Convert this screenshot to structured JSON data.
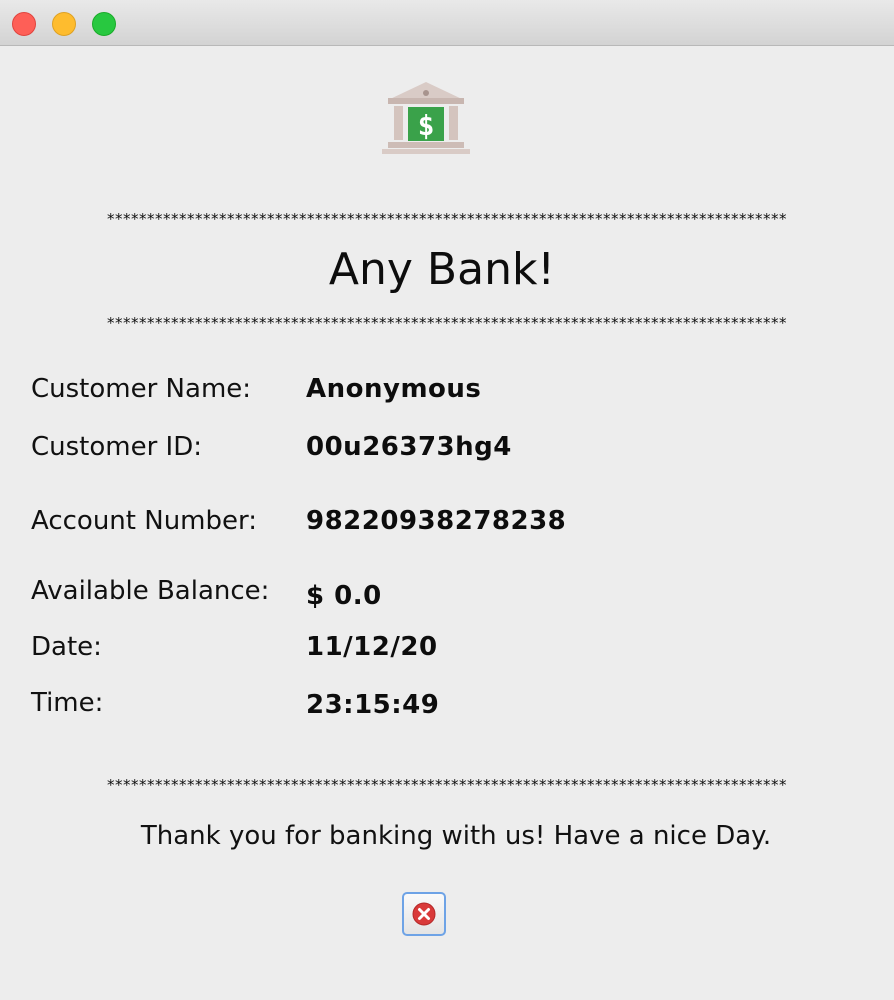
{
  "window": {
    "controls": [
      "close",
      "minimize",
      "maximize"
    ],
    "colors": {
      "close": "#fe5f57",
      "minimize": "#febc2e",
      "maximize": "#28c840"
    }
  },
  "header": {
    "icon": "bank-icon",
    "stars_top": "*************************************************************************************",
    "title": "Any Bank!",
    "stars_bottom": "*************************************************************************************"
  },
  "receipt": {
    "customer_name_label": "Customer Name:",
    "customer_name_value": "Anonymous",
    "customer_id_label": "Customer ID:",
    "customer_id_value": "00u26373hg4",
    "account_number_label": "Account Number:",
    "account_number_value": "98220938278238",
    "balance_label": "Available Balance:",
    "balance_value": "$ 0.0",
    "date_label": "Date:",
    "date_value": "11/12/20",
    "time_label": "Time:",
    "time_value": "23:15:49"
  },
  "footer": {
    "stars": "*************************************************************************************",
    "message": "Thank you for banking with us! Have a nice Day.",
    "close_icon": "close-icon",
    "accent": "#6ea3e6"
  }
}
